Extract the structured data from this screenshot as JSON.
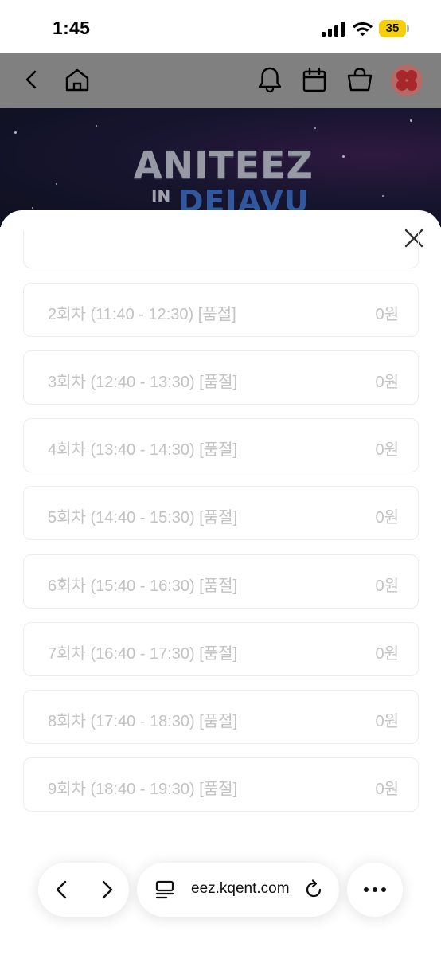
{
  "status_bar": {
    "time": "1:45",
    "battery": "35",
    "icons": [
      "signal-icon",
      "wifi-icon",
      "battery-icon"
    ]
  },
  "header": {
    "icons": [
      "back-arrow-icon",
      "home-icon",
      "bell-icon",
      "calendar-icon",
      "shopping-bag-icon",
      "avatar"
    ]
  },
  "banner": {
    "logo_top": "ANITEEZ",
    "logo_in": "IN",
    "logo_bottom": "DEJAVU"
  },
  "sheet": {
    "close_icon": "close-icon",
    "options": [
      {
        "label": "2회차 (11:40 - 12:30) [품절]",
        "price": "0원"
      },
      {
        "label": "3회차 (12:40 - 13:30) [품절]",
        "price": "0원"
      },
      {
        "label": "4회차 (13:40 - 14:30) [품절]",
        "price": "0원"
      },
      {
        "label": "5회차 (14:40 - 15:30) [품절]",
        "price": "0원"
      },
      {
        "label": "6회차 (15:40 - 16:30) [품절]",
        "price": "0원"
      },
      {
        "label": "7회차 (16:40 - 17:30) [품절]",
        "price": "0원"
      },
      {
        "label": "8회차 (17:40 - 18:30) [품절]",
        "price": "0원"
      },
      {
        "label": "9회차 (18:40 - 19:30) [품절]",
        "price": "0원"
      }
    ]
  },
  "browser": {
    "url": "eez.kqent.com",
    "icons": [
      "browser-back-icon",
      "browser-forward-icon",
      "tabs-icon",
      "reload-icon",
      "more-icon"
    ]
  },
  "colors": {
    "dim_header": "#808080",
    "battery": "#f5cf0a",
    "disabled_text": "#c2c2c2",
    "border": "#ececec"
  }
}
